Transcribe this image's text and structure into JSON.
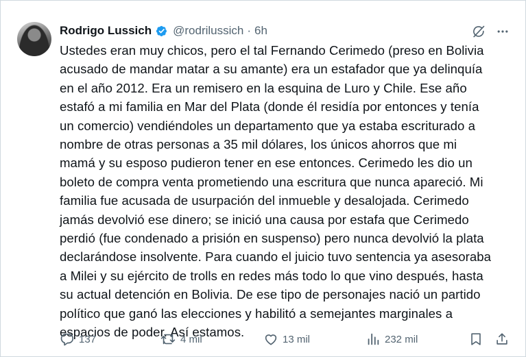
{
  "tweet": {
    "author_name": "Rodrigo Lussich",
    "handle": "@rodrilussich",
    "separator": "·",
    "time": "6h",
    "verified": true,
    "text": "Ustedes eran muy chicos, pero el tal Fernando Cerimedo (preso en Bolivia\nacusado de mandar matar a su amante) era un estafador que ya delinquía\nen el año 2012. Era un remisero en la esquina de Luro y Chile. Ese año\nestafó a mi familia en Mar del Plata (donde él residía por entonces y tenía\nun comercio) vendiéndoles un departamento que ya estaba escriturado a\nnombre de otras personas a 35 mil dólares, los únicos ahorros que mi\nmamá y su esposo pudieron tener en ese entonces. Cerimedo les dio un\nboleto de compra venta prometiendo una escritura que nunca apareció. Mi\nfamilia fue acusada de usurpación del inmueble y desalojada. Cerimedo\njamás devolvió ese dinero; se inició una causa por estafa que Cerimedo\nperdió (fue condenado a prisión en suspenso) pero nunca devolvió la plata\ndeclarándose insolvente. Para cuando el juicio tuvo sentencia ya asesoraba\na Milei y su ejército de trolls en redes más todo lo que vino después, hasta\nsu actual detención en Bolivia. De ese tipo de personajes nació un partido\npolítico que ganó las elecciones y habilitó a semejantes marginales a\nespacios de poder. Así estamos."
  },
  "actions": {
    "replies": "137",
    "reposts": "4 mil",
    "likes": "13 mil",
    "views": "232 mil"
  },
  "icons": {
    "verified": "verified-badge-icon",
    "grok": "grok-icon",
    "more": "more-icon",
    "reply": "reply-icon",
    "repost": "repost-icon",
    "like": "like-icon",
    "views": "views-icon",
    "bookmark": "bookmark-icon",
    "share": "share-icon"
  },
  "colors": {
    "verified_blue": "#1d9bf0",
    "text": "#0f1419",
    "secondary": "#536471",
    "border": "#cfd9de"
  }
}
